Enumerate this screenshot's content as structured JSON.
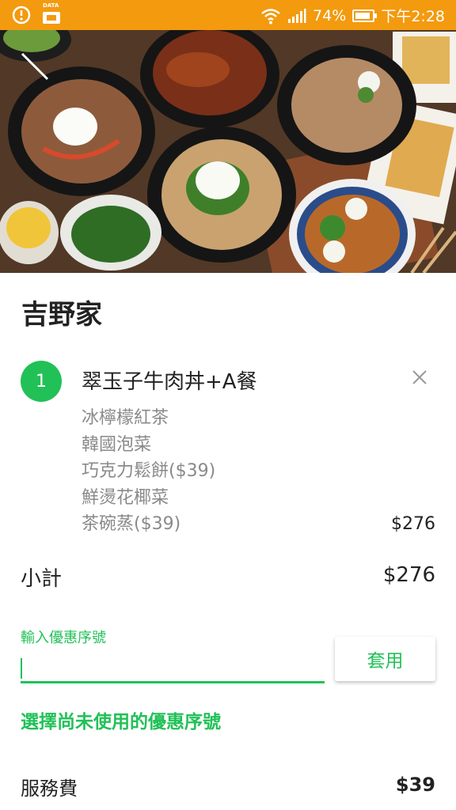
{
  "status_bar": {
    "data_label": "DATA",
    "battery": "74%",
    "time": "下午2:28",
    "color": "#f39a0f"
  },
  "restaurant": {
    "name": "吉野家"
  },
  "order_item": {
    "quantity": "1",
    "name": "翠玉子牛肉丼+A餐",
    "options": [
      "冰檸檬紅茶",
      "韓國泡菜",
      "巧克力鬆餅($39)",
      "鮮燙花椰菜",
      "茶碗蒸($39)"
    ],
    "price": "$276"
  },
  "subtotal": {
    "label": "小計",
    "value": "$276"
  },
  "coupon": {
    "label": "輸入優惠序號",
    "value": "",
    "apply_label": "套用",
    "select_link": "選擇尚未使用的優惠序號"
  },
  "service_fee": {
    "label": "服務費",
    "value": "$39"
  },
  "colors": {
    "accent": "#21c157",
    "statusbar": "#f39a0f"
  },
  "icons": {
    "back": "back-arrow-icon",
    "remove": "close-icon",
    "alarm": "alarm-icon",
    "wifi": "wifi-icon",
    "signal": "signal-icon",
    "battery": "battery-icon"
  }
}
